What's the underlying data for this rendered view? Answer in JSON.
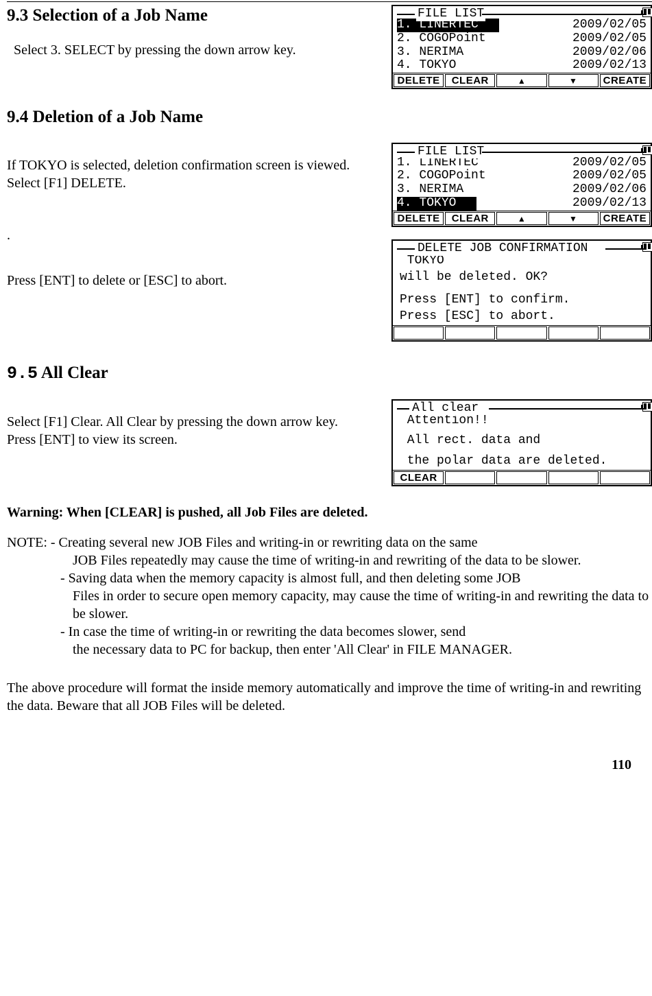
{
  "sections": {
    "s93": {
      "heading": "9.3 Selection of a Job Name",
      "body": "  Select 3. SELECT by pressing the down arrow key."
    },
    "s94": {
      "heading": "9.4 Deletion of a Job Name",
      "body1": "If  TOKYO is selected, deletion confirmation screen is viewed. Select [F1] DELETE.",
      "dot": ".",
      "body2": "Press [ENT] to delete or [ESC] to abort."
    },
    "s95": {
      "heading": "9.5 All Clear",
      "body": "Select [F1] Clear. All Clear by pressing the down arrow key. Press [ENT] to view its screen."
    }
  },
  "warning": "Warning: When [CLEAR] is pushed, all Job Files are deleted.",
  "note": {
    "prefix": "NOTE: ",
    "item1a": "- Creating several new JOB Files and writing-in or rewriting data on the same",
    "item1b": "JOB Files repeatedly may cause the time of writing-in and rewriting of the data to be slower.",
    "item2a": "- Saving data when the memory capacity is almost full, and then deleting some JOB",
    "item2b": "Files in order to secure open memory capacity, may cause the time of writing-in and rewriting the data to be slower.",
    "item3a": "- In case the time of writing-in or rewriting the data becomes slower, send",
    "item3b": "the necessary data to PC for backup, then enter 'All Clear' in FILE MANAGER."
  },
  "trailing": "The above procedure will format the inside memory automatically and improve the time of writing-in and rewriting the data. Beware that all JOB Files will be deleted.",
  "page_number": "110",
  "lcd1": {
    "title": "FILE LIST",
    "rows": [
      {
        "left": "1. LINERTEC",
        "right": "2009/02/05",
        "selected": true
      },
      {
        "left": "2. COGOPoint",
        "right": "2009/02/05",
        "selected": false
      },
      {
        "left": "3. NERIMA",
        "right": "2009/02/06",
        "selected": false
      },
      {
        "left": "4. TOKYO",
        "right": "2009/02/13",
        "selected": false
      }
    ],
    "softkeys": [
      "DELETE",
      "CLEAR",
      "up",
      "down",
      "CREATE"
    ]
  },
  "lcd2": {
    "title": "FILE LIST",
    "rows": [
      {
        "left": "1. LINERTEC",
        "right": "2009/02/05",
        "selected": false
      },
      {
        "left": "2. COGOPoint",
        "right": "2009/02/05",
        "selected": false
      },
      {
        "left": "3. NERIMA",
        "right": "2009/02/06",
        "selected": false
      },
      {
        "left": "4. TOKYO",
        "right": "2009/02/13",
        "selected": true
      }
    ],
    "softkeys": [
      "DELETE",
      "CLEAR",
      "up",
      "down",
      "CREATE"
    ]
  },
  "lcd3": {
    "title": "DELETE JOB CONFIRMATION",
    "line1": " TOKYO",
    "line2": "will be deleted. OK?",
    "line3": "Press [ENT] to confirm.",
    "line4": "Press [ESC] to abort.",
    "softkeys": [
      "",
      "",
      "",
      "",
      ""
    ]
  },
  "lcd4": {
    "title": "All clear",
    "line1": " Attention!!",
    "line2": " All rect. data and",
    "line3": " the polar data are deleted.",
    "softkeys": [
      "CLEAR",
      "",
      "",
      "",
      ""
    ]
  }
}
